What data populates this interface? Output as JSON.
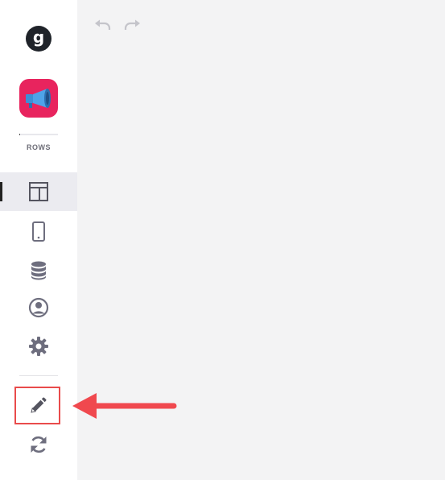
{
  "sidebar": {
    "logo_letter": "g",
    "app": {
      "label": "ROWS",
      "icon": "megaphone-icon",
      "progress_percent": 3
    },
    "nav_items": [
      {
        "name": "layout",
        "icon": "layout-icon",
        "active": true
      },
      {
        "name": "mobile",
        "icon": "mobile-icon"
      },
      {
        "name": "data",
        "icon": "database-icon"
      },
      {
        "name": "users",
        "icon": "user-circle-icon"
      },
      {
        "name": "settings",
        "icon": "gear-icon"
      }
    ],
    "actions": [
      {
        "name": "edit",
        "icon": "pencil-icon",
        "highlighted": true
      },
      {
        "name": "refresh",
        "icon": "refresh-icon"
      }
    ]
  },
  "toolbar": {
    "undo_icon": "undo-icon",
    "redo_icon": "redo-icon"
  },
  "annotation": {
    "arrow_color": "#f0484e",
    "box_color": "#e94b4b"
  },
  "colors": {
    "brand_app": "#e8245e",
    "icon_gray": "#6e6e7e",
    "canvas_bg": "#f3f3f4"
  }
}
